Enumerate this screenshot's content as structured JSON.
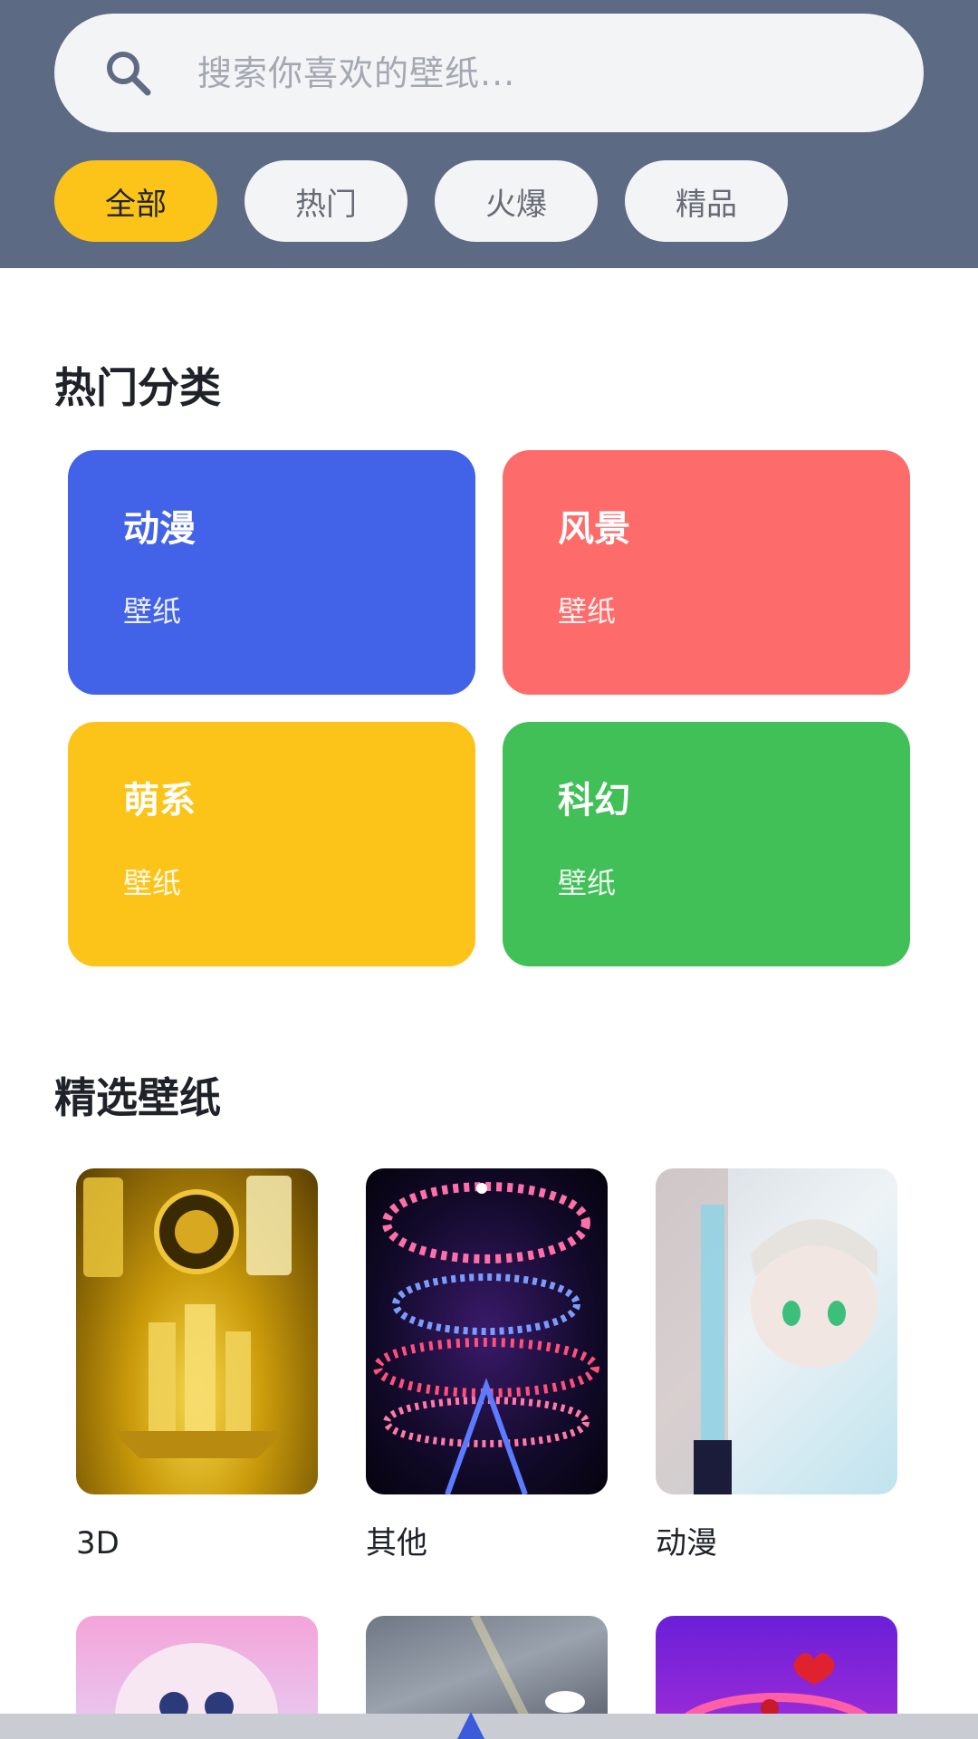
{
  "search": {
    "placeholder": "搜索你喜欢的壁纸..."
  },
  "tabs": [
    {
      "label": "全部",
      "active": true
    },
    {
      "label": "热门",
      "active": false
    },
    {
      "label": "火爆",
      "active": false
    },
    {
      "label": "精品",
      "active": false
    }
  ],
  "hot_categories": {
    "title": "热门分类",
    "items": [
      {
        "title": "动漫",
        "subtitle": "壁纸",
        "color": "#4262e8"
      },
      {
        "title": "风景",
        "subtitle": "壁纸",
        "color": "#fd6b6b"
      },
      {
        "title": "萌系",
        "subtitle": "壁纸",
        "color": "#fcc419"
      },
      {
        "title": "科幻",
        "subtitle": "壁纸",
        "color": "#40c057"
      }
    ]
  },
  "featured": {
    "title": "精选壁纸",
    "items": [
      {
        "label": "3D"
      },
      {
        "label": "其他"
      },
      {
        "label": "动漫"
      }
    ]
  },
  "colors": {
    "header_bg": "#5c6a84",
    "accent": "#fcc419"
  }
}
